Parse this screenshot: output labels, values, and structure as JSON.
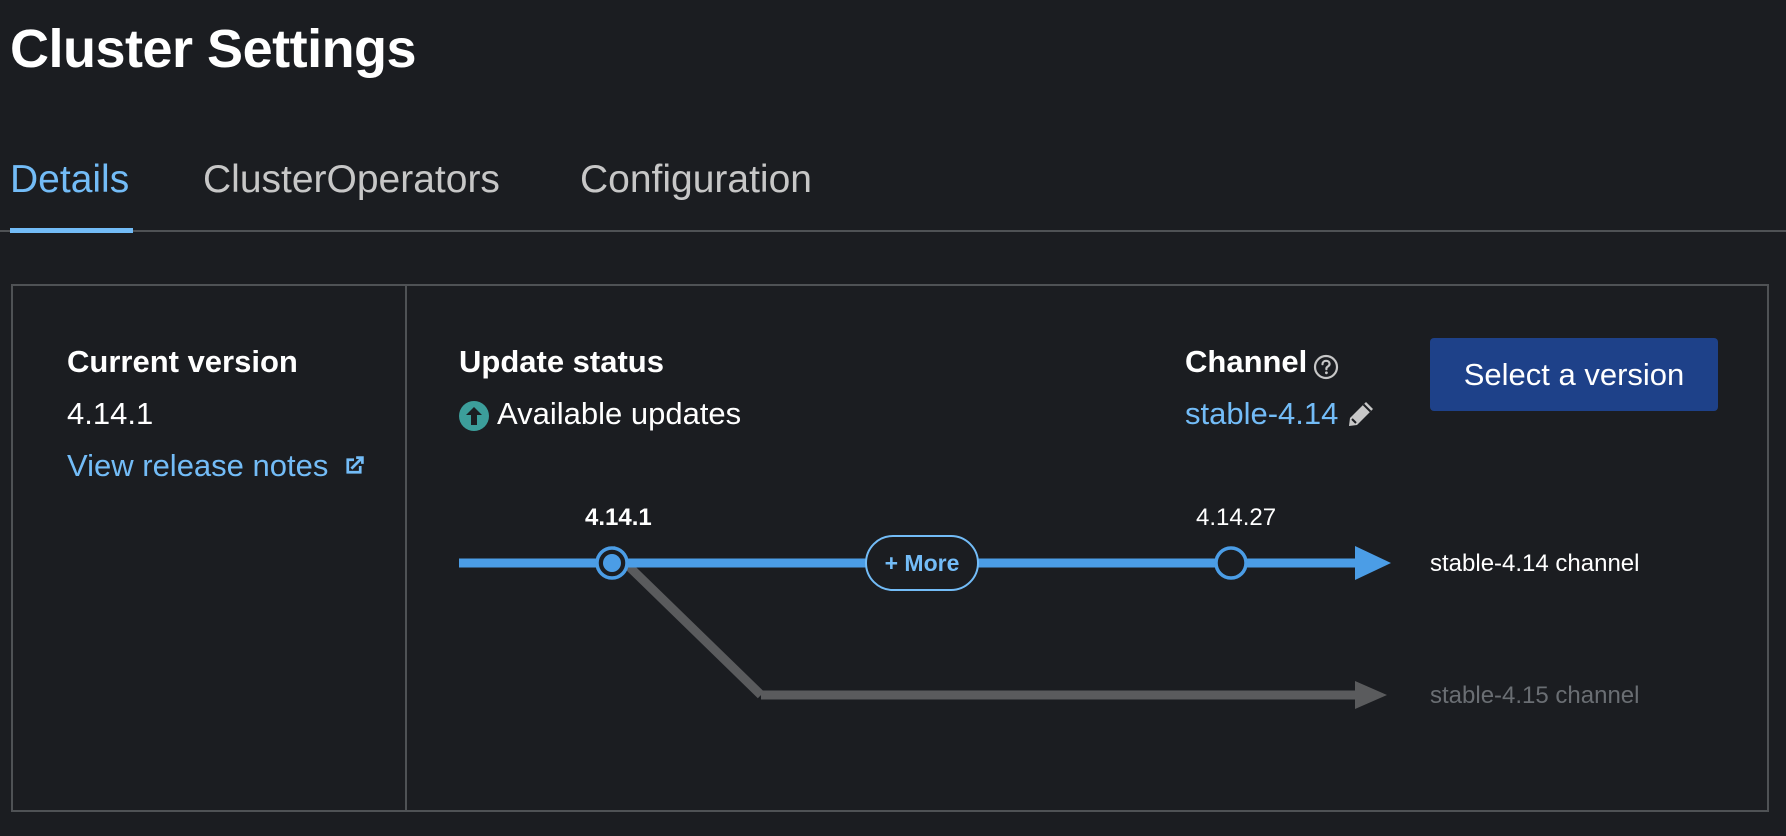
{
  "page": {
    "title": "Cluster Settings"
  },
  "tabs": [
    {
      "label": "Details",
      "active": true
    },
    {
      "label": "ClusterOperators",
      "active": false
    },
    {
      "label": "Configuration",
      "active": false
    }
  ],
  "current_version": {
    "label": "Current version",
    "value": "4.14.1",
    "release_notes_link": "View release notes",
    "link_icon": "external-link-icon"
  },
  "update_status": {
    "label": "Update status",
    "value": "Available updates",
    "icon": "arrow-circle-up-icon",
    "icon_color": "#3c9e9b"
  },
  "channel": {
    "label": "Channel",
    "help_icon": "question-circle-icon",
    "value": "stable-4.14",
    "edit_icon": "pencil-icon"
  },
  "actions": {
    "select_version": "Select a version"
  },
  "update_graph": {
    "current_node": "4.14.1",
    "more_button": "+ More",
    "latest_node": "4.14.27",
    "channels": [
      {
        "label": "stable-4.14 channel",
        "color": "#4b9de6",
        "active": true
      },
      {
        "label": "stable-4.15 channel",
        "color": "#5a5b5d",
        "active": false
      }
    ]
  },
  "colors": {
    "background": "#1b1d21",
    "accent": "#73bcf7",
    "primary_button": "#1e4189",
    "border": "#4f5255"
  }
}
